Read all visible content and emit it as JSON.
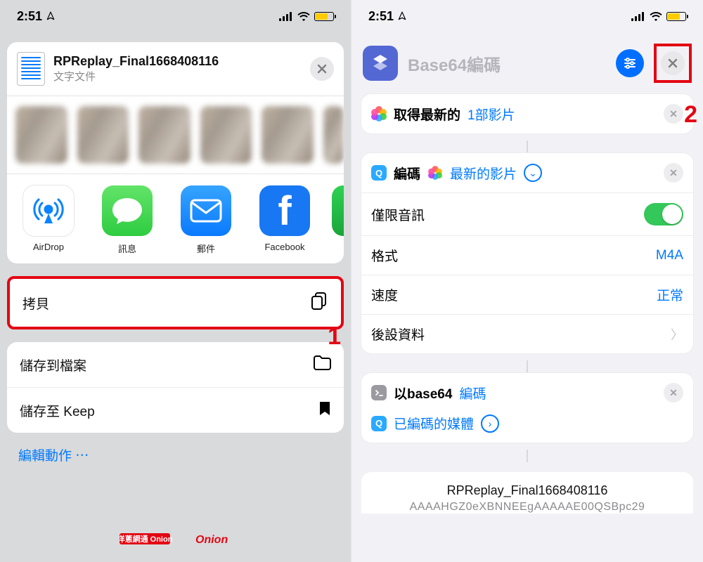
{
  "status": {
    "time": "2:51"
  },
  "left": {
    "file_name": "RPReplay_Final1668408116",
    "file_type": "文字文件",
    "apps": {
      "airdrop": "AirDrop",
      "messages": "訊息",
      "mail": "郵件",
      "facebook": "Facebook"
    },
    "actions": {
      "copy": "拷貝",
      "save_files": "儲存到檔案",
      "save_keep": "儲存至 Keep"
    },
    "edit_actions": "編輯動作 ⋯",
    "annotation": "1"
  },
  "right": {
    "title": "Base64編碼",
    "annotation": "2",
    "step1": {
      "prefix": "取得最新的",
      "count": "1部影片"
    },
    "step2": {
      "encode": "編碼",
      "latest": "最新的影片",
      "audio_only": "僅限音訊",
      "format_label": "格式",
      "format_value": "M4A",
      "speed_label": "速度",
      "speed_value": "正常",
      "metadata": "後設資料"
    },
    "step3": {
      "line1a": "以base64",
      "line1b": "編碼",
      "line2": "已編碼的媒體"
    },
    "preview": {
      "name": "RPReplay_Final1668408116",
      "data": "AAAAHGZ0eXBNNEEgAAAAAE00QSBpc29"
    }
  },
  "watermark": "洋蔥網通 Onion"
}
